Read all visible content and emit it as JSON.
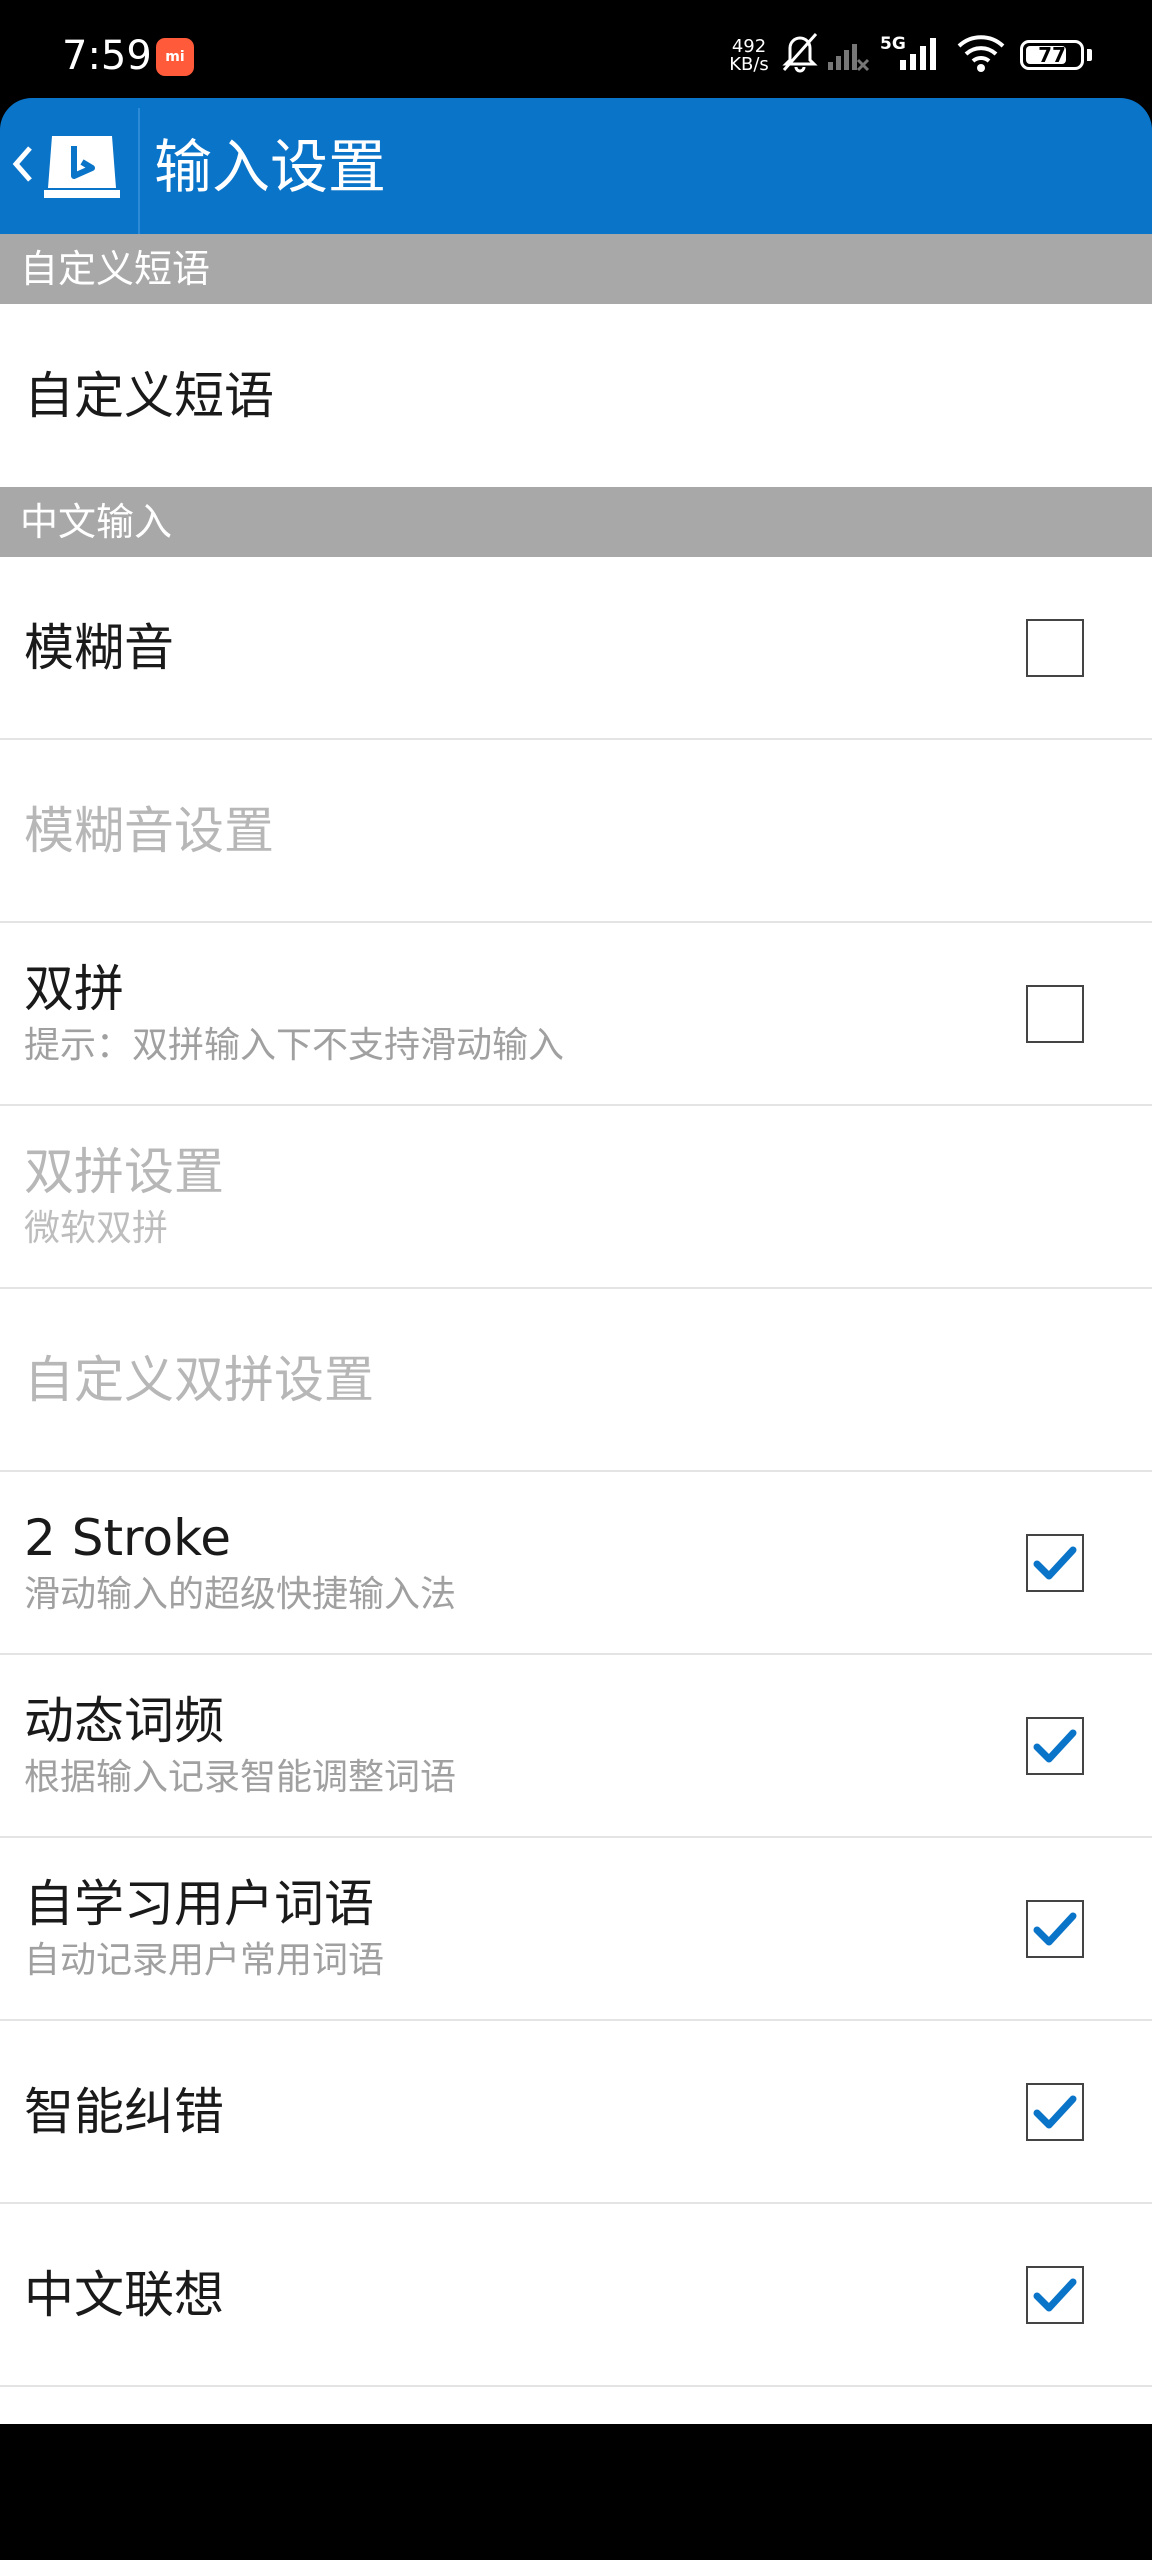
{
  "status_bar": {
    "time": "7:59",
    "mi_badge": "mi",
    "net_speed_value": "492",
    "net_speed_unit": "KB/s",
    "network_type": "5G",
    "battery": "77",
    "battery_level_percent": 77,
    "icons": [
      "mi-app-icon",
      "bell-muted-icon",
      "signal-off-icon",
      "signal-5g-icon",
      "wifi-icon",
      "battery-icon"
    ]
  },
  "app_bar": {
    "title": "输入设置",
    "back_icon": "chevron-left-icon",
    "logo_icon": "bing-logo-icon",
    "color": "#0a74c9"
  },
  "sections": [
    {
      "header": "自定义短语",
      "items": [
        {
          "title": "自定义短语",
          "subtitle": null,
          "enabled": true,
          "checkbox": null
        }
      ]
    },
    {
      "header": "中文输入",
      "items": [
        {
          "title": "模糊音",
          "subtitle": null,
          "enabled": true,
          "checkbox": false
        },
        {
          "title": "模糊音设置",
          "subtitle": null,
          "enabled": false,
          "checkbox": null
        },
        {
          "title": "双拼",
          "subtitle": "提示：双拼输入下不支持滑动输入",
          "enabled": true,
          "checkbox": false
        },
        {
          "title": "双拼设置",
          "subtitle": "微软双拼",
          "enabled": false,
          "checkbox": null
        },
        {
          "title": "自定义双拼设置",
          "subtitle": null,
          "enabled": false,
          "checkbox": null
        },
        {
          "title": "2 Stroke",
          "subtitle": "滑动输入的超级快捷输入法",
          "enabled": true,
          "checkbox": true
        },
        {
          "title": "动态词频",
          "subtitle": "根据输入记录智能调整词语",
          "enabled": true,
          "checkbox": true
        },
        {
          "title": "自学习用户词语",
          "subtitle": "自动记录用户常用词语",
          "enabled": true,
          "checkbox": true
        },
        {
          "title": "智能纠错",
          "subtitle": null,
          "enabled": true,
          "checkbox": true
        },
        {
          "title": "中文联想",
          "subtitle": null,
          "enabled": true,
          "checkbox": true
        }
      ]
    }
  ],
  "colors": {
    "section_header_bg": "#a8a8a8",
    "check_mark": "#0a74c9",
    "disabled_text": "#b7b7b7"
  }
}
